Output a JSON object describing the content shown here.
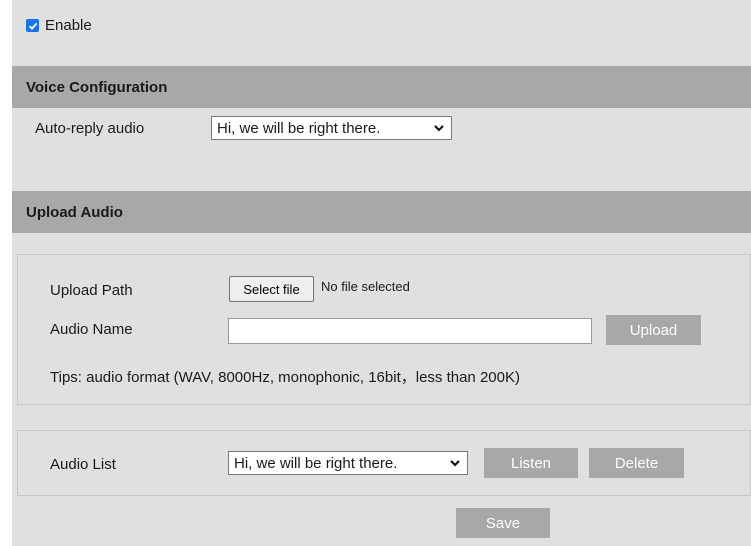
{
  "enable": {
    "label": "Enable",
    "checked": true,
    "accent": "#1a73e8"
  },
  "voice_configuration": {
    "title": "Voice Configuration",
    "auto_reply_label": "Auto-reply audio",
    "auto_reply_value": "Hi, we will be right there."
  },
  "upload_audio": {
    "title": "Upload Audio",
    "upload_path_label": "Upload Path",
    "select_file_label": "Select file",
    "no_file_text": "No file selected",
    "audio_name_label": "Audio Name",
    "audio_name_value": "",
    "upload_button": "Upload",
    "tips": "Tips: audio format (WAV, 8000Hz, monophonic, 16bit，less than 200K)"
  },
  "audio_list": {
    "label": "Audio List",
    "selected": "Hi, we will be right there.",
    "listen_button": "Listen",
    "delete_button": "Delete"
  },
  "save_button": "Save",
  "icons": {
    "checkbox": "checkmark-icon",
    "dropdown": "chevron-down-icon"
  }
}
